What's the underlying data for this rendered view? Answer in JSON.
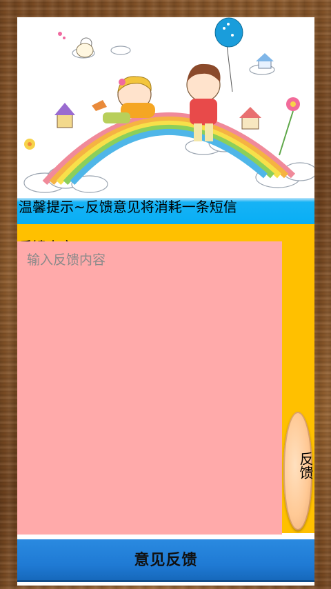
{
  "banner": {
    "illustration": "children-on-rainbow-illustration"
  },
  "tip": {
    "text": "温馨提示~反馈意见将消耗一条短信"
  },
  "form": {
    "label": "反馈内容",
    "placeholder": "输入反馈内容",
    "value": ""
  },
  "side_button": {
    "label": "反馈"
  },
  "bottom_button": {
    "label": "意见反馈"
  },
  "colors": {
    "tip_bar": "#08aef5",
    "form_background": "#ffc000",
    "input_background": "#ffaaaa",
    "bottom_bar": "#1f7ad4",
    "side_button": "#ffc995"
  }
}
